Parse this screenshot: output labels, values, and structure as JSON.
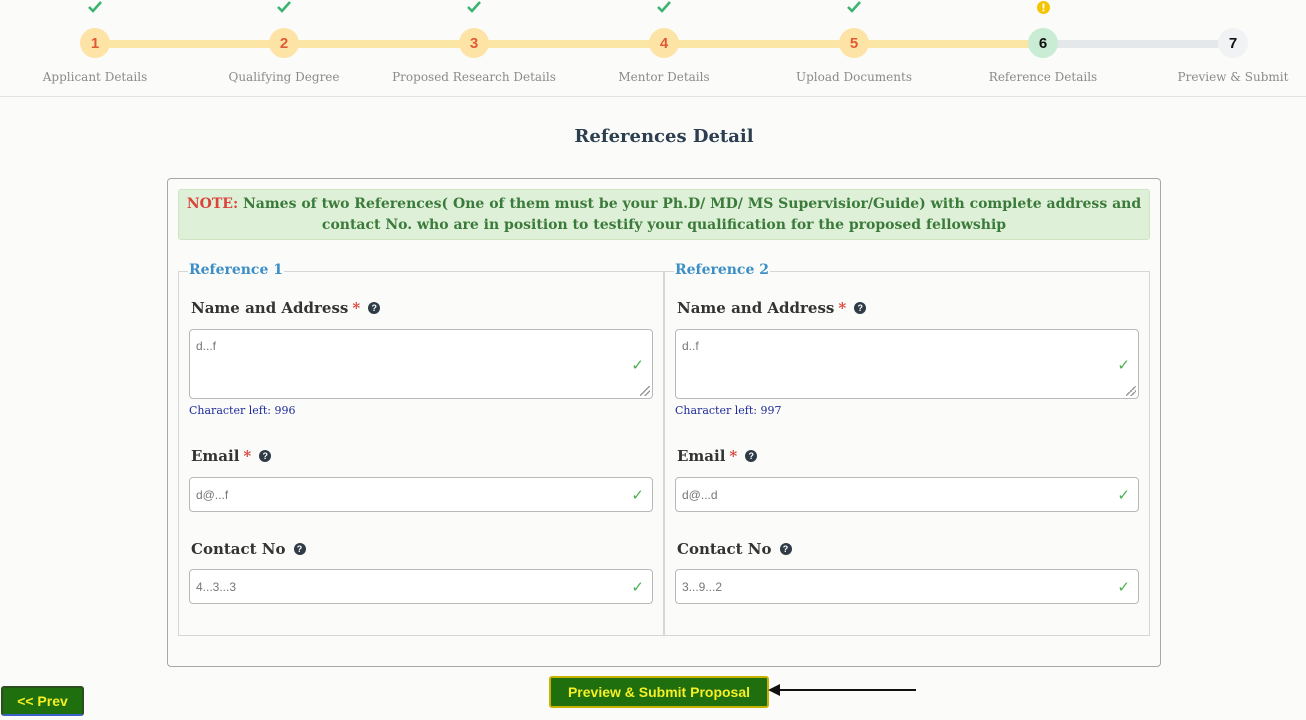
{
  "stepper": {
    "steps": [
      {
        "number": "1",
        "label": "Applicant Details",
        "status": "done"
      },
      {
        "number": "2",
        "label": "Qualifying Degree",
        "status": "done"
      },
      {
        "number": "3",
        "label": "Proposed Research Details",
        "status": "done"
      },
      {
        "number": "4",
        "label": "Mentor Details",
        "status": "done"
      },
      {
        "number": "5",
        "label": "Upload Documents",
        "status": "done"
      },
      {
        "number": "6",
        "label": "Reference Details",
        "status": "active"
      },
      {
        "number": "7",
        "label": "Preview & Submit",
        "status": "pending"
      }
    ],
    "done_icon": "check-icon",
    "active_icon": "warning-icon"
  },
  "page": {
    "title": "References Detail"
  },
  "note": {
    "key": "NOTE:",
    "text": " Names of two References( One of them must be your Ph.D/ MD/ MS Supervisior/Guide) with complete address and contact No. who are in position to testify your qualification for the proposed fellowship"
  },
  "reference1": {
    "legend": "Reference 1",
    "name_label": "Name and Address",
    "name_value": "d...f",
    "char_left": "Character left: 996",
    "email_label": "Email",
    "email_value": "d@...f",
    "contact_label": "Contact No",
    "contact_value": "4...3...3"
  },
  "reference2": {
    "legend": "Reference 2",
    "name_label": "Name and Address",
    "name_value": "d..f",
    "char_left": "Character left: 997",
    "email_label": "Email",
    "email_value": "d@...d",
    "contact_label": "Contact No",
    "contact_value": "3...9...2"
  },
  "common": {
    "required_mark": "*",
    "help_glyph": "?",
    "check_glyph": "✓"
  },
  "buttons": {
    "submit": "Preview & Submit Proposal",
    "prev": "<< Prev"
  },
  "colors": {
    "done_circle": "#fde4a6",
    "done_number": "#e05a35",
    "active_circle": "#c8ecd4",
    "check_green": "#4caf50",
    "warning_yellow": "#f5c400",
    "legend_blue": "#3b8ec6",
    "button_green": "#1f6f0f",
    "button_text": "#f5ef24"
  }
}
